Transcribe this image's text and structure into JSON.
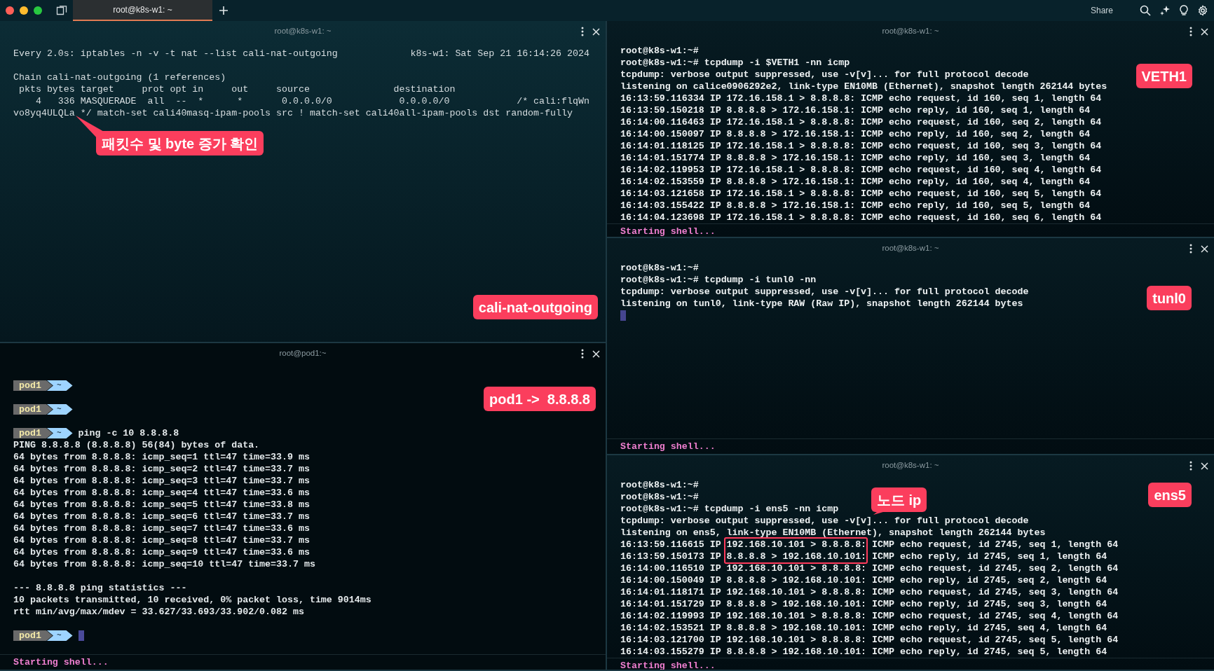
{
  "tab_bar": {
    "tabs": [
      {
        "title": "root@k8s-w1: ~",
        "selected": true
      }
    ],
    "share": "Share"
  },
  "panes": [
    {
      "kind": "watch",
      "title": "root@k8s-w1: ~",
      "lines": [
        "Every 2.0s: iptables -n -v -t nat --list cali-nat-outgoing             k8s-w1: Sat Sep 21 16:14:26 2024",
        {
          "kind": "blank"
        },
        "Chain cali-nat-outgoing (1 references)",
        " pkts bytes target     prot opt in     out     source               destination",
        "    4   336 MASQUERADE  all  --  *      *       0.0.0.0/0            0.0.0.0/0            /* cali:flqWn",
        "vo8yq4ULQLa */ match-set cali40masq-ipam-pools src ! match-set cali40all-ipam-pools dst random-fully"
      ],
      "annotations": [
        {
          "text": "패킷수 및 byte 증가 확인",
          "kind": "pointer"
        },
        {
          "text": "cali-nat-outgoing",
          "kind": "label"
        }
      ]
    },
    {
      "kind": "pod-shell",
      "title": "root@pod1:~",
      "lines": [
        {
          "kind": "prompt",
          "host": "pod1",
          "dir": "~",
          "cursor": false
        },
        {
          "kind": "blank"
        },
        {
          "kind": "prompt",
          "host": "pod1",
          "dir": "~",
          "cursor": false
        },
        {
          "kind": "blank"
        },
        {
          "kind": "prompt",
          "host": "pod1",
          "dir": "~",
          "command": "ping -c 10 8.8.8.8",
          "cursor": false
        },
        "PING 8.8.8.8 (8.8.8.8) 56(84) bytes of data.",
        "64 bytes from 8.8.8.8: icmp_seq=1 ttl=47 time=33.9 ms",
        "64 bytes from 8.8.8.8: icmp_seq=2 ttl=47 time=33.7 ms",
        "64 bytes from 8.8.8.8: icmp_seq=3 ttl=47 time=33.7 ms",
        "64 bytes from 8.8.8.8: icmp_seq=4 ttl=47 time=33.6 ms",
        "64 bytes from 8.8.8.8: icmp_seq=5 ttl=47 time=33.8 ms",
        "64 bytes from 8.8.8.8: icmp_seq=6 ttl=47 time=33.7 ms",
        "64 bytes from 8.8.8.8: icmp_seq=7 ttl=47 time=33.6 ms",
        "64 bytes from 8.8.8.8: icmp_seq=8 ttl=47 time=33.7 ms",
        "64 bytes from 8.8.8.8: icmp_seq=9 ttl=47 time=33.6 ms",
        "64 bytes from 8.8.8.8: icmp_seq=10 ttl=47 time=33.7 ms",
        {
          "kind": "blank"
        },
        "--- 8.8.8.8 ping statistics ---",
        "10 packets transmitted, 10 received, 0% packet loss, time 9014ms",
        "rtt min/avg/max/mdev = 33.627/33.693/33.902/0.082 ms",
        {
          "kind": "blank"
        },
        {
          "kind": "prompt",
          "host": "pod1",
          "dir": "~",
          "cursor": true
        }
      ],
      "annotations": [
        {
          "text": "pod1 ->  8.8.8.8",
          "kind": "label"
        }
      ],
      "footer": "Starting shell..."
    },
    {
      "kind": "node-shell",
      "title": "root@k8s-w1: ~",
      "lines": [
        "root@k8s-w1:~#",
        "root@k8s-w1:~# tcpdump -i $VETH1 -nn icmp",
        "tcpdump: verbose output suppressed, use -v[v]... for full protocol decode",
        "listening on calice0906292e2, link-type EN10MB (Ethernet), snapshot length 262144 bytes",
        "16:13:59.116334 IP 172.16.158.1 > 8.8.8.8: ICMP echo request, id 160, seq 1, length 64",
        "16:13:59.150218 IP 8.8.8.8 > 172.16.158.1: ICMP echo reply, id 160, seq 1, length 64",
        "16:14:00.116463 IP 172.16.158.1 > 8.8.8.8: ICMP echo request, id 160, seq 2, length 64",
        "16:14:00.150097 IP 8.8.8.8 > 172.16.158.1: ICMP echo reply, id 160, seq 2, length 64",
        "16:14:01.118125 IP 172.16.158.1 > 8.8.8.8: ICMP echo request, id 160, seq 3, length 64",
        "16:14:01.151774 IP 8.8.8.8 > 172.16.158.1: ICMP echo reply, id 160, seq 3, length 64",
        "16:14:02.119953 IP 172.16.158.1 > 8.8.8.8: ICMP echo request, id 160, seq 4, length 64",
        "16:14:02.153559 IP 8.8.8.8 > 172.16.158.1: ICMP echo reply, id 160, seq 4, length 64",
        "16:14:03.121658 IP 172.16.158.1 > 8.8.8.8: ICMP echo request, id 160, seq 5, length 64",
        "16:14:03.155422 IP 8.8.8.8 > 172.16.158.1: ICMP echo reply, id 160, seq 5, length 64",
        "16:14:04.123698 IP 172.16.158.1 > 8.8.8.8: ICMP echo request, id 160, seq 6, length 64"
      ],
      "annotations": [
        {
          "text": "VETH1",
          "kind": "label"
        }
      ],
      "footer": "Starting shell..."
    },
    {
      "kind": "node-shell",
      "title": "root@k8s-w1: ~",
      "lines": [
        "root@k8s-w1:~#",
        "root@k8s-w1:~# tcpdump -i tunl0 -nn",
        "tcpdump: verbose output suppressed, use -v[v]... for full protocol decode",
        "listening on tunl0, link-type RAW (Raw IP), snapshot length 262144 bytes",
        {
          "kind": "cursor"
        }
      ],
      "annotations": [
        {
          "text": "tunl0",
          "kind": "label"
        }
      ],
      "footer": "Starting shell..."
    },
    {
      "kind": "node-shell",
      "title": "root@k8s-w1: ~",
      "lines": [
        "root@k8s-w1:~#",
        "root@k8s-w1:~#",
        "root@k8s-w1:~# tcpdump -i ens5 -nn icmp",
        "tcpdump: verbose output suppressed, use -v[v]... for full protocol decode",
        "listening on ens5, link-type EN10MB (Ethernet), snapshot length 262144 bytes",
        {
          "kind": "highlighted",
          "prefix": "16:13:59.116615 IP ",
          "highlight": "192.168.10.101 > 8.8.8.8:",
          "suffix": " ICMP echo request, id 2745, seq 1, length 64"
        },
        {
          "kind": "highlighted",
          "prefix": "16:13:59.150173 IP ",
          "highlight": "8.8.8.8 > 192.168.10.101:",
          "suffix": " ICMP echo reply, id 2745, seq 1, length 64"
        },
        "16:14:00.116510 IP 192.168.10.101 > 8.8.8.8: ICMP echo request, id 2745, seq 2, length 64",
        "16:14:00.150049 IP 8.8.8.8 > 192.168.10.101: ICMP echo reply, id 2745, seq 2, length 64",
        "16:14:01.118171 IP 192.168.10.101 > 8.8.8.8: ICMP echo request, id 2745, seq 3, length 64",
        "16:14:01.151729 IP 8.8.8.8 > 192.168.10.101: ICMP echo reply, id 2745, seq 3, length 64",
        "16:14:02.119993 IP 192.168.10.101 > 8.8.8.8: ICMP echo request, id 2745, seq 4, length 64",
        "16:14:02.153521 IP 8.8.8.8 > 192.168.10.101: ICMP echo reply, id 2745, seq 4, length 64",
        "16:14:03.121700 IP 192.168.10.101 > 8.8.8.8: ICMP echo request, id 2745, seq 5, length 64",
        "16:14:03.155279 IP 8.8.8.8 > 192.168.10.101: ICMP echo reply, id 2745, seq 5, length 64"
      ],
      "annotations": [
        {
          "text": "ens5",
          "kind": "label"
        },
        {
          "text": "노드 ip",
          "kind": "bubble"
        }
      ],
      "footer": "Starting shell..."
    }
  ]
}
